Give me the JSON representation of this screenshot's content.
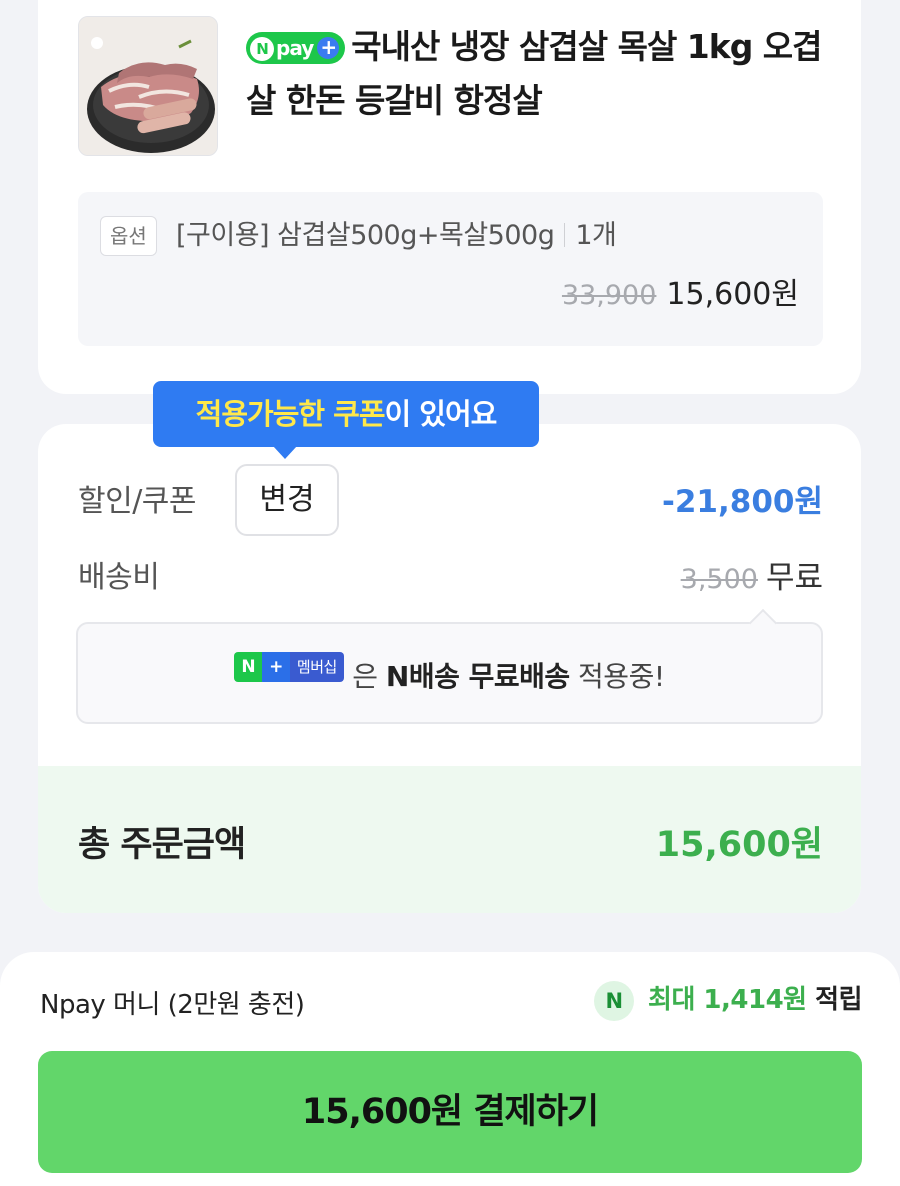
{
  "product": {
    "title": "국내산 냉장 삼겹살 목살 1kg 오겹살 한돈 등갈비 항정살",
    "npay_badge": "pay",
    "option_tag": "옵션",
    "option_name": "[구이용] 삼겹살500g+목살500g",
    "quantity": "1개",
    "original_price": "33,900",
    "sale_price": "15,600원"
  },
  "coupon_tip": {
    "highlight": "적용가능한 쿠폰",
    "rest": "이 있어요"
  },
  "summary": {
    "discount_label": "할인/쿠폰",
    "change_label": "변경",
    "discount_value": "-21,800원",
    "shipping_label": "배송비",
    "shipping_original": "3,500",
    "shipping_value": "무료",
    "membership": {
      "badge_n": "N",
      "badge_plus": "+",
      "badge_text": "멤버십",
      "particle": "은",
      "bold": "N배송 무료배송",
      "rest": "적용중!"
    },
    "total_label": "총 주문금액",
    "total_value": "15,600원"
  },
  "payment": {
    "method": "Npay 머니 (2만원 충전)",
    "reward_prefix": "최대 1,414원",
    "reward_suffix": "적립",
    "pay_button": "15,600원 결제하기"
  },
  "colors": {
    "npay_green": "#1dc74a",
    "discount_blue": "#3a7ee0",
    "total_green": "#3caf4e",
    "pay_button": "#62d66a",
    "tooltip_blue": "#2f7bf2"
  }
}
